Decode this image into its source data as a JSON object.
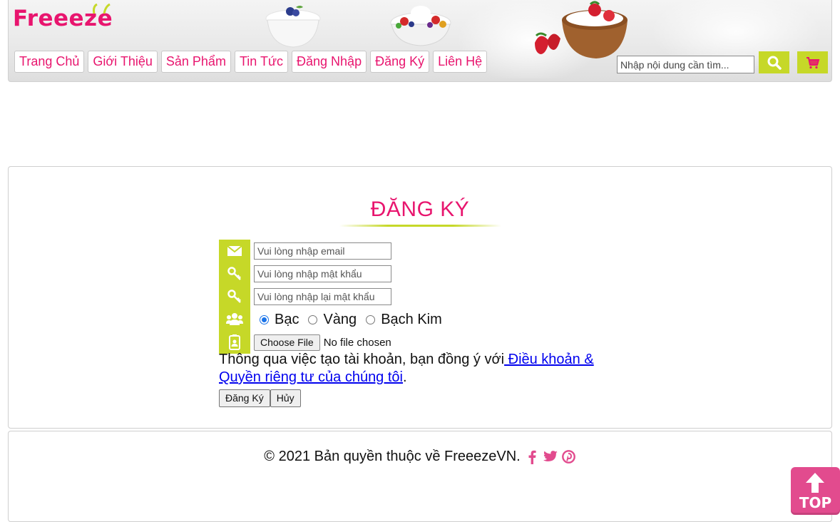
{
  "header": {
    "logo_text": "Freeeze",
    "nav": [
      {
        "label": "Trang Chủ"
      },
      {
        "label": "Giới Thiệu"
      },
      {
        "label": "Sản Phẩm"
      },
      {
        "label": "Tin Tức"
      },
      {
        "label": "Đăng Nhập"
      },
      {
        "label": "Đăng Ký"
      },
      {
        "label": "Liên Hệ"
      }
    ],
    "search_placeholder": "Nhập nội dung cần tìm...",
    "search_icon": "search-icon",
    "cart_icon": "cart-icon",
    "accent_color": "#c6d828",
    "brand_color": "#e8156e"
  },
  "form": {
    "title": "ĐĂNG KÝ",
    "email_placeholder": "Vui lòng nhập email",
    "password_placeholder": "Vui lòng nhập mật khẩu",
    "confirm_placeholder": "Vui lòng nhập lại mật khẩu",
    "tiers": [
      {
        "label": "Bạc",
        "checked": true
      },
      {
        "label": "Vàng",
        "checked": false
      },
      {
        "label": "Bạch Kim",
        "checked": false
      }
    ],
    "file_button": "Choose File",
    "file_status": "No file chosen",
    "terms_text": "Thông qua việc tạo tài khoản, bạn đồng ý với",
    "terms_link": " Điều khoản & Quyền riêng tư của chúng tôi",
    "terms_end": ".",
    "submit_label": "Đăng Ký",
    "cancel_label": "Hủy"
  },
  "footer": {
    "copyright": "© 2021 Bản quyền thuộc về FreeezeVN.",
    "social": [
      "facebook-icon",
      "twitter-icon",
      "pinterest-icon"
    ]
  },
  "top_button": {
    "label": "TOP"
  }
}
